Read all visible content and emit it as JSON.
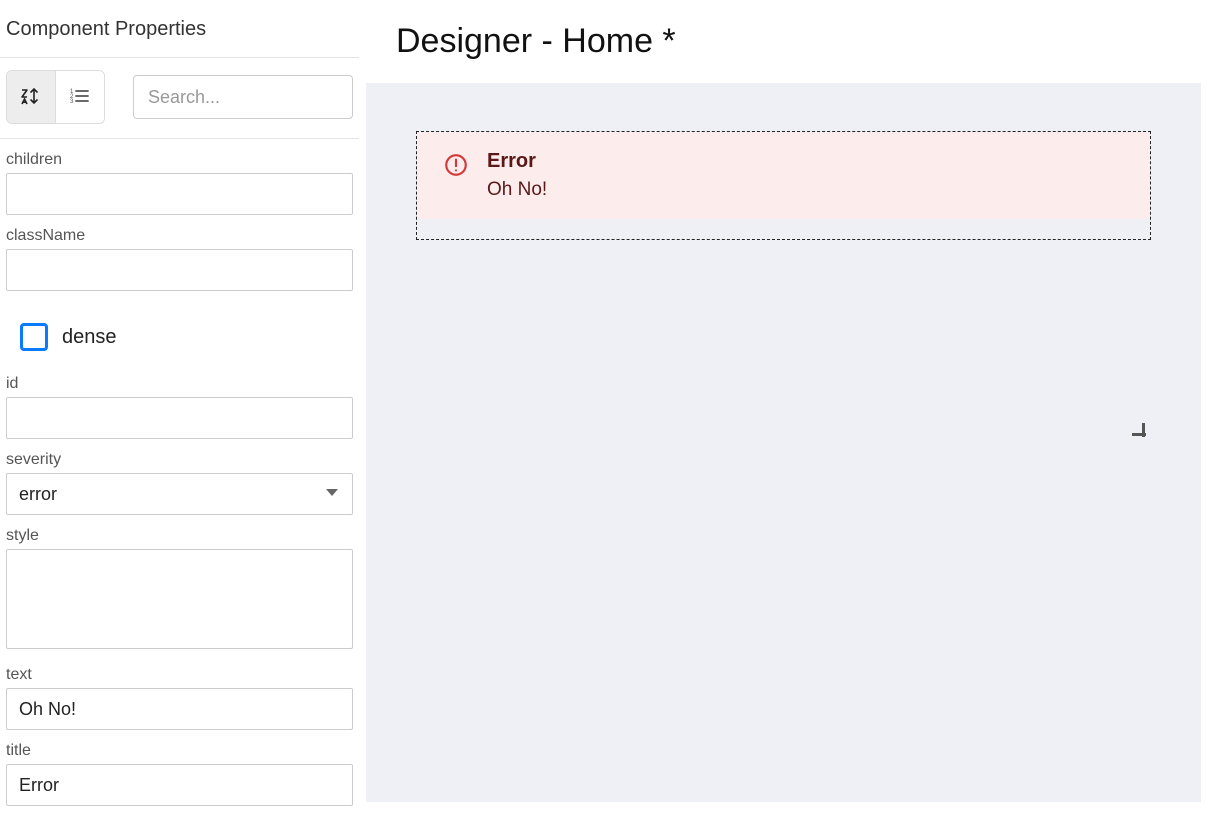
{
  "sidebar": {
    "title": "Component Properties",
    "search_placeholder": "Search...",
    "props": {
      "children": {
        "label": "children",
        "value": ""
      },
      "className": {
        "label": "className",
        "value": ""
      },
      "dense": {
        "label": "dense",
        "checked": false
      },
      "id": {
        "label": "id",
        "value": ""
      },
      "severity": {
        "label": "severity",
        "value": "error"
      },
      "style": {
        "label": "style",
        "value": ""
      },
      "text": {
        "label": "text",
        "value": "Oh No!"
      },
      "title": {
        "label": "title",
        "value": "Error"
      }
    }
  },
  "main": {
    "title": "Designer - Home *"
  },
  "alert": {
    "title": "Error",
    "text": "Oh No!"
  }
}
